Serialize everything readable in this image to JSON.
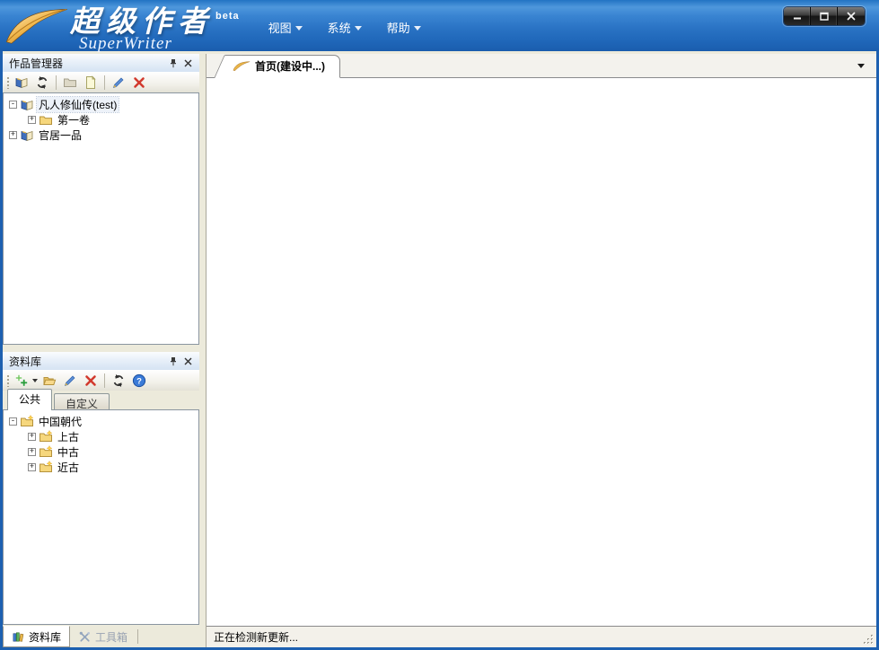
{
  "titlebar": {
    "logo_cn": "超级作者",
    "logo_en": "SuperWriter",
    "beta": "beta",
    "menus": [
      {
        "label": "视图"
      },
      {
        "label": "系统"
      },
      {
        "label": "帮助"
      }
    ]
  },
  "works_panel": {
    "title": "作品管理器",
    "toolbar_icons": [
      "book-add",
      "refresh",
      "folder",
      "new-document",
      "edit-pen",
      "delete-x"
    ],
    "tree": [
      {
        "label": "凡人修仙传(test)",
        "icon": "book",
        "expander": "-",
        "level": 0,
        "selected": true
      },
      {
        "label": "第一卷",
        "icon": "folder",
        "expander": "+",
        "level": 1,
        "selected": false
      },
      {
        "label": "官居一品",
        "icon": "book",
        "expander": "+",
        "level": 0,
        "selected": false
      }
    ]
  },
  "library_panel": {
    "title": "资料库",
    "toolbar_icons": [
      "add-plus",
      "add-dropdown",
      "open-folder",
      "edit-pen",
      "delete-x",
      "refresh",
      "help"
    ],
    "tabs": [
      {
        "label": "公共",
        "active": true
      },
      {
        "label": "自定义",
        "active": false
      }
    ],
    "tree": [
      {
        "label": "中国朝代",
        "icon": "folder-sparkle",
        "expander": "-",
        "level": 0
      },
      {
        "label": "上古",
        "icon": "folder-sparkle",
        "expander": "+",
        "level": 1
      },
      {
        "label": "中古",
        "icon": "folder-sparkle",
        "expander": "+",
        "level": 1
      },
      {
        "label": "近古",
        "icon": "folder-sparkle",
        "expander": "+",
        "level": 1
      }
    ]
  },
  "bottom_tabs": [
    {
      "label": "资料库",
      "active": true
    },
    {
      "label": "工具箱",
      "active": false
    }
  ],
  "main": {
    "tab_label": "首页(建设中...)",
    "status_text": "正在检测新更新..."
  },
  "help_glyph": "?",
  "colors": {
    "header_blue": "#2e78c9",
    "window_border": "#1d60b0",
    "caption_gradient_from": "#fafcfe",
    "caption_gradient_to": "#d5e3f3",
    "icon_red": "#d23a2e",
    "icon_green": "#2f9e3f",
    "icon_blue_pen": "#5b8fd6",
    "folder_gold": "#f6d77d"
  }
}
